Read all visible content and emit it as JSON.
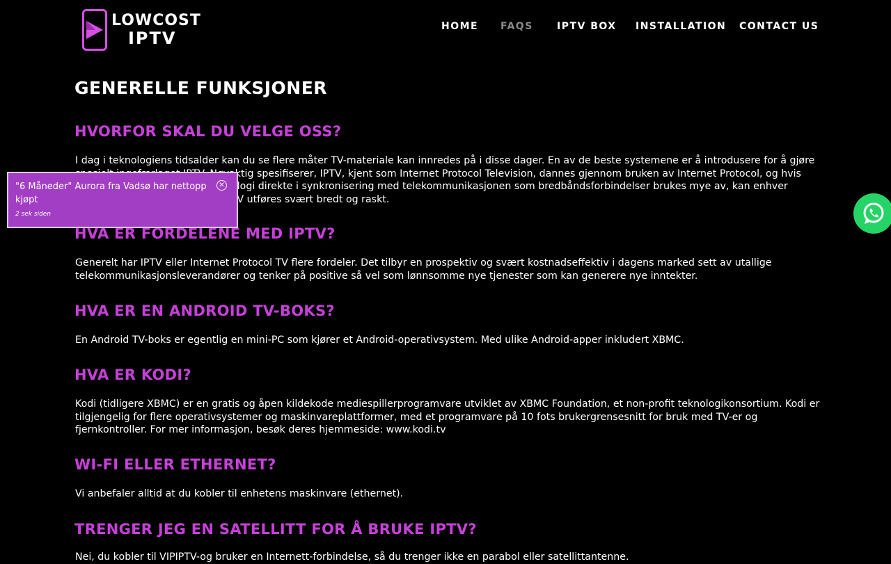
{
  "logo": {
    "line1": "LOWCOST",
    "line2": "IPTV",
    "icon": "play-icon",
    "accent_color": "#d64fe3"
  },
  "nav": {
    "items": [
      {
        "label": "HOME",
        "active": false
      },
      {
        "label": "FAQS",
        "active": true
      },
      {
        "label": "IPTV BOX",
        "active": false
      },
      {
        "label": "INSTALLATION",
        "active": false
      },
      {
        "label": "CONTACT US",
        "active": false
      }
    ]
  },
  "main": {
    "title": "GENERELLE FUNKSJONER",
    "heading_color": "#c740d9",
    "sections": [
      {
        "heading": "HVORFOR SKAL DU VELGE OSS?",
        "text": "I dag i teknologiens tidsalder kan du se flere måter TV-materiale kan innredes på i disse dager. En av de beste systemene er å introdusere for å gjøre spesielt ingefærlaget IPTV. Nøyaktig spesifiserer, IPTV, kjent som Internet Protocol Television, dannes gjennom bruken av Internet Protocol, og hvis dette blir fulgt, deltar IPTV-teknologi direkte i synkronisering med telekommunikasjonen som bredbåndsforbindelser brukes mye av, kan enhver tjeneste som gjøres gjennom IPTV utføres svært bredt og raskt."
      },
      {
        "heading": "HVA ER FORDELENE MED IPTV?",
        "text": "Generelt har IPTV eller Internet Protocol TV flere fordeler. Det tilbyr en prospektiv og svært kostnadseffektiv i dagens marked sett av utallige telekommunikasjonsleverandører og tenker på positive så vel som lønnsomme nye tjenester som kan generere nye inntekter."
      },
      {
        "heading": "HVA ER EN ANDROID TV-BOKS?",
        "text": "En Android TV-boks er egentlig en mini-PC som kjører et Android-operativsystem. Med ulike Android-apper inkludert XBMC."
      },
      {
        "heading": "HVA ER KODI?",
        "text": "Kodi (tidligere XBMC) er en gratis og åpen kildekode mediespillerprogramvare utviklet av XBMC Foundation, et non-profit teknologikonsortium. Kodi er tilgjengelig for flere operativsystemer og maskinvareplattformer, med et programvare på 10 fots brukergrensesnitt for bruk med TV-er og fjernkontroller. For mer informasjon, besøk deres hjemmeside: www.kodi.tv"
      },
      {
        "heading": "WI-FI ELLER ETHERNET?",
        "text": "Vi anbefaler alltid at du kobler til enhetens maskinvare (ethernet)."
      },
      {
        "heading": "TRENGER JEG EN SATELLITT FOR Å BRUKE IPTV?",
        "text": "Nei, du kobler til VIPIPTV-og bruker en Internett-forbindelse, så du trenger ikke en parabol eller satellittantenne."
      }
    ]
  },
  "toast": {
    "message": "\"6 Måneder\" Aurora fra Vadsø har nettopp kjøpt",
    "time": "2 sek siden",
    "close_icon": "close-circle-icon",
    "background": "#a23ec4"
  },
  "whatsapp": {
    "icon": "whatsapp-icon",
    "color": "#25d366"
  }
}
